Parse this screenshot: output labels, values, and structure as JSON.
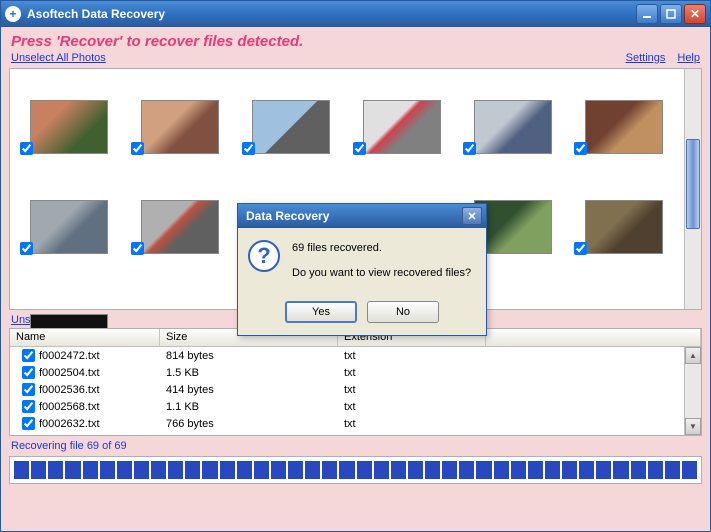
{
  "titlebar": {
    "title": "Asoftech Data Recovery"
  },
  "instruction": "Press 'Recover' to recover files detected.",
  "links": {
    "unselect_photos": "Unselect All Photos",
    "settings": "Settings",
    "help": "Help",
    "unselect_files": "Unselect All Files"
  },
  "filelist": {
    "headers": {
      "name": "Name",
      "size": "Size",
      "ext": "Extension"
    },
    "rows": [
      {
        "name": "f0002472.txt",
        "size": "814 bytes",
        "ext": "txt"
      },
      {
        "name": "f0002504.txt",
        "size": "1.5 KB",
        "ext": "txt"
      },
      {
        "name": "f0002536.txt",
        "size": "414 bytes",
        "ext": "txt"
      },
      {
        "name": "f0002568.txt",
        "size": "1.1 KB",
        "ext": "txt"
      },
      {
        "name": "f0002632.txt",
        "size": "766 bytes",
        "ext": "txt"
      }
    ]
  },
  "status": "Recovering file 69 of 69",
  "dialog": {
    "title": "Data Recovery",
    "line1": "69 files recovered.",
    "line2": "Do you want to view recovered files?",
    "yes": "Yes",
    "no": "No"
  }
}
